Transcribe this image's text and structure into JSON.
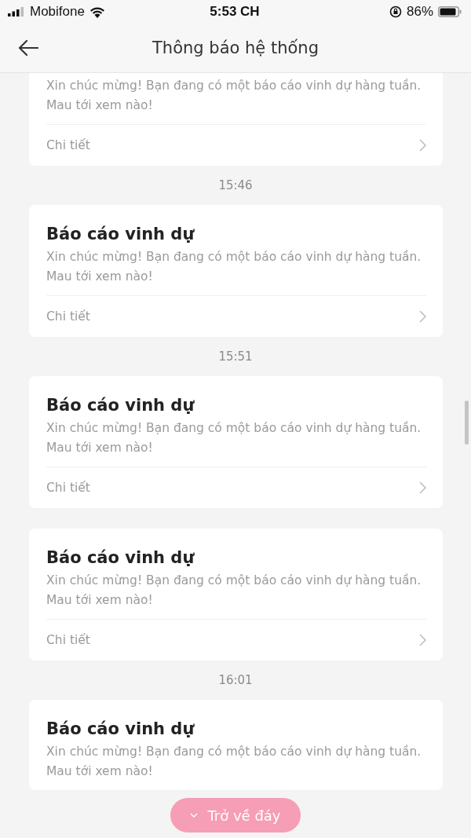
{
  "status_bar": {
    "carrier": "Mobifone",
    "time": "5:53 CH",
    "battery": "86%"
  },
  "header": {
    "title": "Thông báo hệ thống"
  },
  "notifications": [
    {
      "message": "Xin chúc mừng! Bạn đang có một báo cáo vinh dự hàng tuần. Mau tới xem nào!",
      "link": "Chi tiết"
    },
    {
      "time": "15:46",
      "title": "Báo cáo vinh dự",
      "message": "Xin chúc mừng! Bạn đang có một báo cáo vinh dự hàng tuần. Mau tới xem nào!",
      "link": "Chi tiết"
    },
    {
      "time": "15:51",
      "title": "Báo cáo vinh dự",
      "message": "Xin chúc mừng! Bạn đang có một báo cáo vinh dự hàng tuần. Mau tới xem nào!",
      "link": "Chi tiết"
    },
    {
      "title": "Báo cáo vinh dự",
      "message": "Xin chúc mừng! Bạn đang có một báo cáo vinh dự hàng tuần. Mau tới xem nào!",
      "link": "Chi tiết"
    },
    {
      "time": "16:01",
      "title": "Báo cáo vinh dự",
      "message": "Xin chúc mừng! Bạn đang có một báo cáo vinh dự hàng tuần. Mau tới xem nào!"
    }
  ],
  "scroll_button": {
    "label": "Trở về đáy"
  }
}
